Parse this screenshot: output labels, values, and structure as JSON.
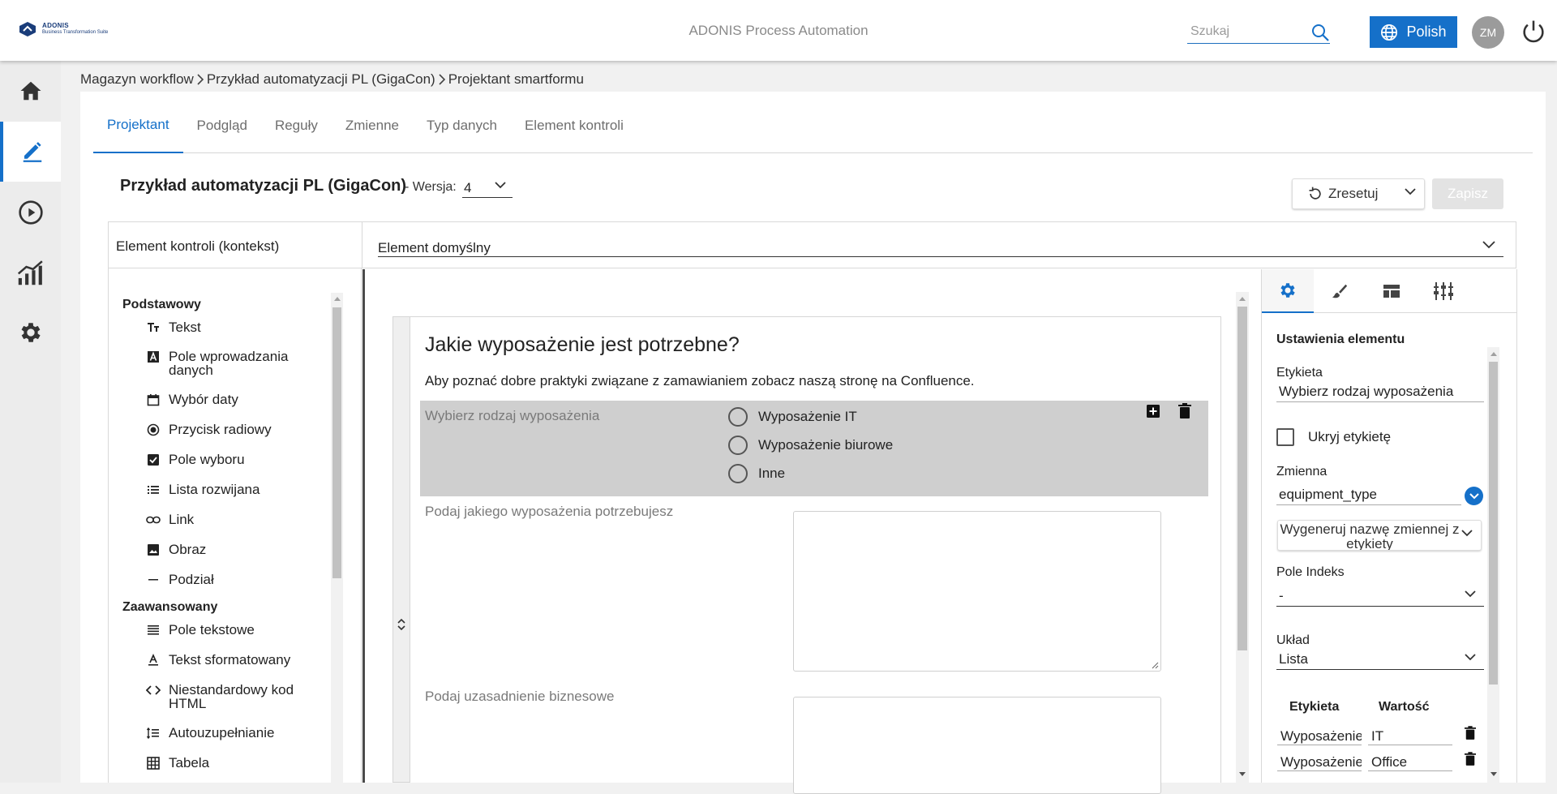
{
  "header": {
    "logo_name": "ADONIS",
    "logo_sub": "Business Transformation Suite",
    "app_title": "ADONIS Process Automation",
    "search_placeholder": "Szukaj",
    "language_label": "Polish",
    "user_initials": "ZM"
  },
  "nav": {
    "items": [
      "home-icon",
      "edit-icon",
      "play-icon",
      "analytics-icon",
      "settings-icon"
    ],
    "active_index": 1
  },
  "breadcrumb": [
    "Magazyn workflow",
    "Przykład automatyzacji PL (GigaCon)",
    "Projektant smartformu"
  ],
  "tabs": [
    {
      "label": "Projektant",
      "active": true
    },
    {
      "label": "Podgląd",
      "active": false
    },
    {
      "label": "Reguły",
      "active": false
    },
    {
      "label": "Zmienne",
      "active": false
    },
    {
      "label": "Typ danych",
      "active": false
    },
    {
      "label": "Element kontroli",
      "active": false
    }
  ],
  "toolbar": {
    "form_title": "Przykład automatyzacji PL (GigaCon)",
    "version_label": "- Wersja:",
    "version_value": "4",
    "reset_label": "Zresetuj",
    "save_label": "Zapisz"
  },
  "context": {
    "label": "Element kontroli (kontekst)",
    "value": "Element domyślny"
  },
  "palette": {
    "basic_header": "Podstawowy",
    "basic_items": [
      {
        "label": "Tekst",
        "icon": "text-format-icon"
      },
      {
        "label": "Pole wprowadzania danych",
        "icon": "input-field-icon"
      },
      {
        "label": "Wybór daty",
        "icon": "calendar-icon"
      },
      {
        "label": "Przycisk radiowy",
        "icon": "radio-icon"
      },
      {
        "label": "Pole wyboru",
        "icon": "checkbox-icon"
      },
      {
        "label": "Lista rozwijana",
        "icon": "list-icon"
      },
      {
        "label": "Link",
        "icon": "link-icon"
      },
      {
        "label": "Obraz",
        "icon": "image-icon"
      },
      {
        "label": "Podział",
        "icon": "divider-icon"
      }
    ],
    "advanced_header": "Zaawansowany",
    "advanced_items": [
      {
        "label": "Pole tekstowe",
        "icon": "textarea-icon"
      },
      {
        "label": "Tekst sformatowany",
        "icon": "rich-text-icon"
      },
      {
        "label": "Niestandardowy kod HTML",
        "icon": "code-icon"
      },
      {
        "label": "Autouzupełnianie",
        "icon": "autocomplete-icon"
      },
      {
        "label": "Tabela",
        "icon": "table-icon"
      }
    ]
  },
  "canvas": {
    "heading": "Jakie wyposażenie jest potrzebne?",
    "description": "Aby poznać dobre praktyki związane z zamawianiem zobacz naszą stronę na Confluence.",
    "select_label": "Wybierz rodzaj wyposażenia",
    "options": [
      "Wyposażenie IT",
      "Wyposażenie biurowe",
      "Inne"
    ],
    "field2_label": "Podaj jakiego wyposażenia potrzebujesz",
    "field3_label": "Podaj uzasadnienie biznesowe"
  },
  "properties": {
    "title": "Ustawienia elementu",
    "label_caption": "Etykieta",
    "label_value": "Wybierz rodzaj wyposażenia",
    "hide_label": "Ukryj etykietę",
    "variable_caption": "Zmienna",
    "variable_value": "equipment_type",
    "generate_label": "Wygeneruj nazwę zmiennej z etykiety",
    "index_caption": "Pole Indeks",
    "index_value": "-",
    "layout_caption": "Układ",
    "layout_value": "Lista",
    "table_headers": [
      "Etykieta",
      "Wartość"
    ],
    "table_rows": [
      {
        "label": "Wyposażenie IT",
        "value": "IT"
      },
      {
        "label": "Wyposażenie biurowe",
        "value": "Office"
      }
    ]
  },
  "colors": {
    "accent": "#1570c9",
    "selected_row": "#cfcfcf"
  }
}
